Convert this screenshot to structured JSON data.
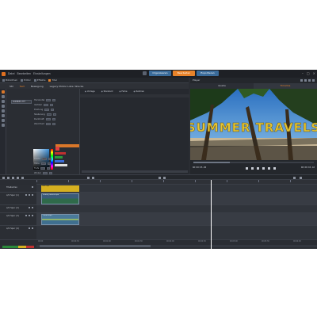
{
  "menu": [
    "Datei",
    "Bearbeiten",
    "Einstellungen"
  ],
  "mode_tabs": [
    "Organisieren",
    "Bearbeiten",
    "Exportieren"
  ],
  "panel_tabs": [
    "Bibliothek",
    "Editor",
    "Effekte",
    "Titel"
  ],
  "subtabs": [
    "Stil",
    "Text",
    "Bewegung",
    "Legacy Motion Liste: Wrecke"
  ],
  "font_select": "ZOMBIES.TTF",
  "props": [
    "Horizontal",
    "Vertikal",
    "Drehung",
    "Skalierung",
    "Deckkraft",
    "Weichheit"
  ],
  "props2": [
    "Breite",
    "Höhe",
    "Tiefe",
    "Winkel",
    "Schatten"
  ],
  "library_tabs": [
    "Vorlage",
    "Standard",
    "Farbe",
    "Rahmen"
  ],
  "viewer": {
    "title": "Player",
    "tabs": [
      "Quelle",
      "Timeline"
    ],
    "timecode_left": "00:00:05.00",
    "timecode_right": "00:00:03.10",
    "overlay_text": "SUMMER TRAVELS"
  },
  "tracks": [
    {
      "name": "Titelkarten",
      "type": "title"
    },
    {
      "name": "A/V Spur (1)",
      "type": "video"
    },
    {
      "name": "A/V Spur (2)",
      "type": "video"
    },
    {
      "name": "A/V Spur (3)",
      "type": "video"
    },
    {
      "name": "A/V Spur (4)",
      "type": "audio"
    }
  ],
  "clips": {
    "title": "Titel Clip",
    "video1": "Strand_Palmen.mp4",
    "video2": "Ozean.mp4"
  },
  "ruler_labels": [
    "00:00",
    "00:00:30",
    "00:01:00",
    "00:01:30",
    "00:02:00",
    "00:02:30",
    "00:03:00",
    "00:03:30",
    "00:04:00"
  ],
  "colors": {
    "accent": "#e8832a",
    "blue": "#3a6b9a",
    "title_clip": "#d6b020"
  }
}
